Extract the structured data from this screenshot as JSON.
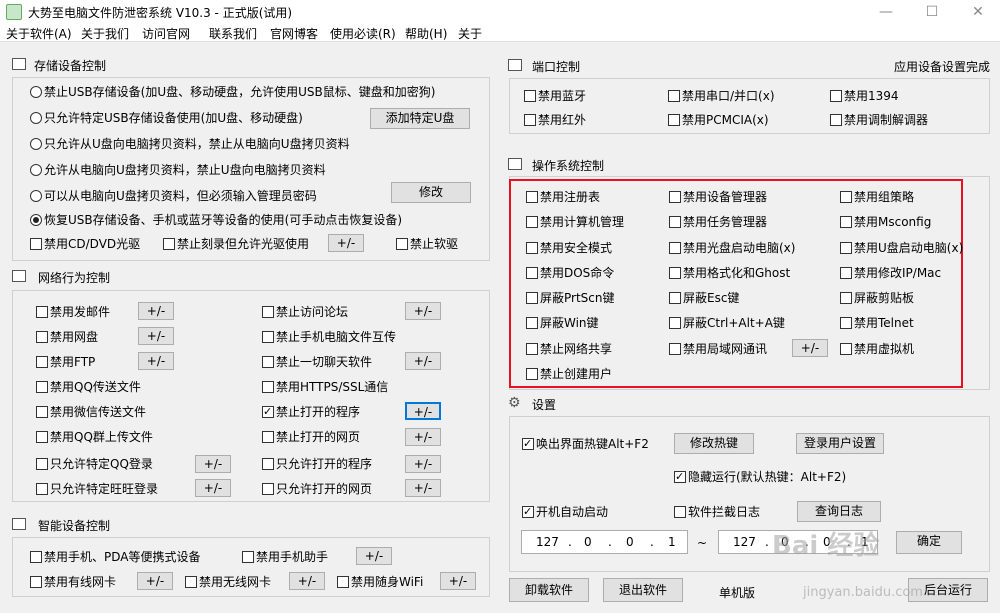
{
  "window": {
    "title": "大势至电脑文件防泄密系统 V10.3 - 正式版(试用)",
    "min_glyph": "—",
    "max_glyph": "☐",
    "close_glyph": "✕"
  },
  "menu": [
    "关于软件(A)",
    "关于我们",
    "访问官网",
    "联系我们",
    "官网博客",
    "使用必读(R)",
    "帮助(H)",
    "关于"
  ],
  "storage": {
    "title": "存储设备控制",
    "radios": [
      "禁止USB存储设备(加U盘、移动硬盘，允许使用USB鼠标、键盘和加密狗)",
      "只允许特定USB存储设备使用(加U盘、移动硬盘)",
      "只允许从U盘向电脑拷贝资料，禁止从电脑向U盘拷贝资料",
      "允许从电脑向U盘拷贝资料，禁止U盘向电脑拷贝资料",
      "可以从电脑向U盘拷贝资料，但必须输入管理员密码",
      "恢复USB存储设备、手机或蓝牙等设备的使用(可手动点击恢复设备)"
    ],
    "add_udisk": "添加特定U盘",
    "modify": "修改",
    "cd_disable": "禁用CD/DVD光驱",
    "cd_burn": "禁止刻录但允许光驱使用",
    "floppy": "禁止软驱",
    "pm": "+/-"
  },
  "network": {
    "title": "网络行为控制",
    "left": [
      "禁用发邮件",
      "禁用网盘",
      "禁用FTP",
      "禁用QQ传送文件",
      "禁用微信传送文件",
      "禁用QQ群上传文件",
      "只允许特定QQ登录",
      "只允许特定旺旺登录"
    ],
    "right": [
      "禁止访问论坛",
      "禁止手机电脑文件互传",
      "禁止一切聊天软件",
      "禁用HTTPS/SSL通信",
      "禁止打开的程序",
      "禁止打开的网页",
      "只允许打开的程序",
      "只允许打开的网页"
    ],
    "pm": "+/-"
  },
  "smart": {
    "title": "智能设备控制",
    "phone_pda": "禁用手机、PDA等便携式设备",
    "phone_assist": "禁用手机助手",
    "wired": "禁用有线网卡",
    "wireless": "禁用无线网卡",
    "wifi": "禁用随身WiFi",
    "pm": "+/-"
  },
  "port": {
    "title": "端口控制",
    "status": "应用设备设置完成",
    "items": [
      "禁用蓝牙",
      "禁用串口/并口(x)",
      "禁用1394",
      "禁用红外",
      "禁用PCMCIA(x)",
      "禁用调制解调器"
    ]
  },
  "os": {
    "title": "操作系统控制",
    "col1": [
      "禁用注册表",
      "禁用计算机管理",
      "禁用安全模式",
      "禁用DOS命令",
      "屏蔽PrtScn键",
      "屏蔽Win键",
      "禁止网络共享",
      "禁止创建用户"
    ],
    "col2": [
      "禁用设备管理器",
      "禁用任务管理器",
      "禁用光盘启动电脑(x)",
      "禁用格式化和Ghost",
      "屏蔽Esc键",
      "屏蔽Ctrl+Alt+A键",
      "禁用局域网通讯"
    ],
    "col3": [
      "禁用组策略",
      "禁用Msconfig",
      "禁用U盘启动电脑(x)",
      "禁用修改IP/Mac",
      "屏蔽剪贴板",
      "禁用Telnet",
      "禁用虚拟机"
    ],
    "pm": "+/-"
  },
  "settings": {
    "title": "设置",
    "hotkey_label": "唤出界面热键Alt+F2",
    "modify_hotkey": "修改热键",
    "login_user": "登录用户设置",
    "hidden_run": "隐藏运行(默认热键：Alt+F2)",
    "autostart": "开机自动启动",
    "intercept_log": "软件拦截日志",
    "query_log": "查询日志",
    "ip_from": [
      "127",
      "0",
      "0",
      "1"
    ],
    "ip_to": [
      "127",
      "0",
      "0",
      "1"
    ],
    "ip_sep": "~",
    "confirm": "确定"
  },
  "footer": {
    "uninstall": "卸载软件",
    "exit": "退出软件",
    "edition": "单机版",
    "background": "后台运行"
  },
  "watermark": {
    "main": "Bai 经验",
    "sub": "jingyan.baidu.com"
  }
}
